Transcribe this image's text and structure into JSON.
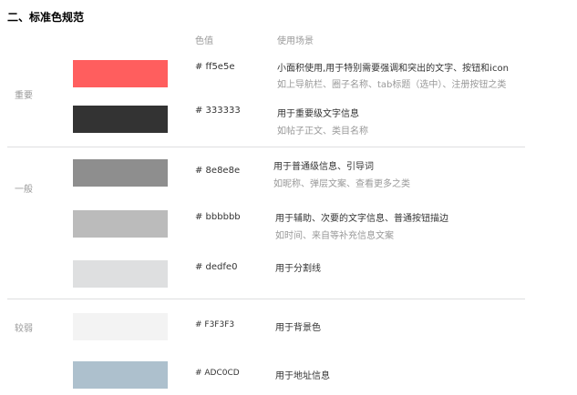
{
  "section_title": "二、标准色规范",
  "headers": {
    "color_value": "色值",
    "usage": "使用场景"
  },
  "groups": [
    {
      "label": "重要"
    },
    {
      "label": "一般"
    },
    {
      "label": "较弱"
    }
  ],
  "colors": [
    {
      "swatch_color": "#ff5e5e",
      "hex_label": "# ff5e5e",
      "usage": "小面积使用,用于特别需要强调和突出的文字、按钮和icon",
      "usage_detail": "如上导航栏、圈子名称、tab标题（选中）、注册按钮之类"
    },
    {
      "swatch_color": "#333333",
      "hex_label": "# 333333",
      "usage": "用于重要级文字信息",
      "usage_detail": "如帖子正文、类目名称"
    },
    {
      "swatch_color": "#8e8e8e",
      "hex_label": "# 8e8e8e",
      "usage": "用于普通级信息、引导词",
      "usage_detail": "如昵称、弹层文案、查看更多之类"
    },
    {
      "swatch_color": "#bbbbbb",
      "hex_label": "# bbbbbb",
      "usage": "用于辅助、次要的文字信息、普通按钮描边",
      "usage_detail": "如时间、来自等补充信息文案"
    },
    {
      "swatch_color": "#dedfe0",
      "hex_label": "# dedfe0",
      "usage": "用于分割线",
      "usage_detail": ""
    },
    {
      "swatch_color": "#f3f3f3",
      "hex_label": "# F3F3F3",
      "usage": "用于背景色",
      "usage_detail": ""
    },
    {
      "swatch_color": "#adc0cd",
      "hex_label": "# ADC0CD",
      "usage": "用于地址信息",
      "usage_detail": ""
    }
  ]
}
